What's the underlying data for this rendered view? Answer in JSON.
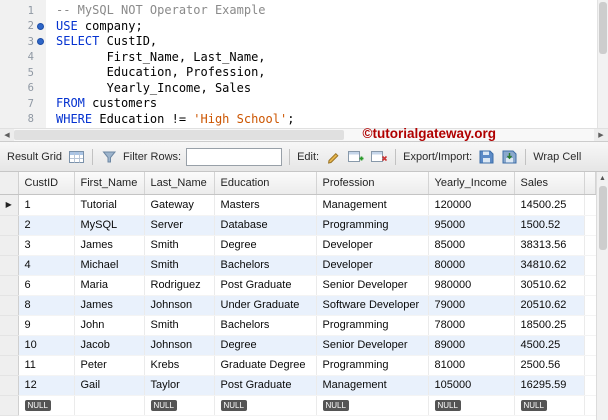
{
  "editor": {
    "watermark": "©tutorialgateway.org",
    "lines": [
      {
        "num": "1",
        "marker": false,
        "segments": [
          {
            "type": "comment",
            "text": "-- MySQL NOT Operator Example"
          }
        ]
      },
      {
        "num": "2",
        "marker": true,
        "segments": [
          {
            "type": "keyword",
            "text": "USE"
          },
          {
            "type": "plain",
            "text": " company;"
          }
        ]
      },
      {
        "num": "3",
        "marker": true,
        "segments": [
          {
            "type": "keyword",
            "text": "SELECT"
          },
          {
            "type": "plain",
            "text": " CustID,"
          }
        ]
      },
      {
        "num": "4",
        "marker": false,
        "segments": [
          {
            "type": "plain",
            "text": "       First_Name, Last_Name,"
          }
        ]
      },
      {
        "num": "5",
        "marker": false,
        "segments": [
          {
            "type": "plain",
            "text": "       Education, Profession,"
          }
        ]
      },
      {
        "num": "6",
        "marker": false,
        "segments": [
          {
            "type": "plain",
            "text": "       Yearly_Income, Sales"
          }
        ]
      },
      {
        "num": "7",
        "marker": false,
        "segments": [
          {
            "type": "keyword",
            "text": "FROM"
          },
          {
            "type": "plain",
            "text": " customers"
          }
        ]
      },
      {
        "num": "8",
        "marker": false,
        "segments": [
          {
            "type": "keyword",
            "text": "WHERE"
          },
          {
            "type": "plain",
            "text": " Education != "
          },
          {
            "type": "string",
            "text": "'High School'"
          },
          {
            "type": "plain",
            "text": ";"
          }
        ]
      }
    ]
  },
  "toolbar": {
    "result_grid_label": "Result Grid",
    "filter_label": "Filter Rows:",
    "filter_value": "",
    "edit_label": "Edit:",
    "export_label": "Export/Import:",
    "wrap_label": "Wrap Cell"
  },
  "grid": {
    "columns": [
      "CustID",
      "First_Name",
      "Last_Name",
      "Education",
      "Profession",
      "Yearly_Income",
      "Sales"
    ],
    "rows": [
      [
        "1",
        "Tutorial",
        "Gateway",
        "Masters",
        "Management",
        "120000",
        "14500.25"
      ],
      [
        "2",
        "MySQL",
        "Server",
        "Database",
        "Programming",
        "95000",
        "1500.52"
      ],
      [
        "3",
        "James",
        "Smith",
        "Degree",
        "Developer",
        "85000",
        "38313.56"
      ],
      [
        "4",
        "Michael",
        "Smith",
        "Bachelors",
        "Developer",
        "80000",
        "34810.62"
      ],
      [
        "6",
        "Maria",
        "Rodriguez",
        "Post Graduate",
        "Senior Developer",
        "980000",
        "30510.62"
      ],
      [
        "8",
        "James",
        "Johnson",
        "Under Graduate",
        "Software Developer",
        "79000",
        "20510.62"
      ],
      [
        "9",
        "John",
        "Smith",
        "Bachelors",
        "Programming",
        "78000",
        "18500.25"
      ],
      [
        "10",
        "Jacob",
        "Johnson",
        "Degree",
        "Senior Developer",
        "89000",
        "4500.25"
      ],
      [
        "11",
        "Peter",
        "Krebs",
        "Graduate Degree",
        "Programming",
        "81000",
        "2500.56"
      ],
      [
        "12",
        "Gail",
        "Taylor",
        "Post Graduate",
        "Management",
        "105000",
        "16295.59"
      ]
    ],
    "null_row": [
      "NULL",
      "",
      "NULL",
      "NULL",
      "NULL",
      "NULL",
      "NULL"
    ]
  }
}
